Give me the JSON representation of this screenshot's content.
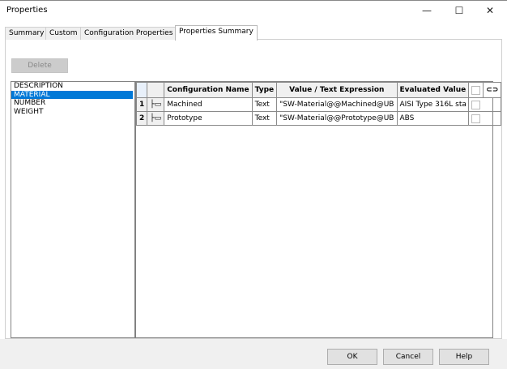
{
  "window": {
    "title": "Properties",
    "minimize": "—",
    "maximize": "☐",
    "close": "✕"
  },
  "tabs": [
    {
      "label": "Summary"
    },
    {
      "label": "Custom"
    },
    {
      "label": "Configuration Properties"
    },
    {
      "label": "Properties Summary",
      "active": true
    }
  ],
  "toolbar": {
    "delete_label": "Delete"
  },
  "properties_list": {
    "items": [
      "DESCRIPTION",
      "MATERIAL",
      "NUMBER",
      "WEIGHT"
    ],
    "selected": "MATERIAL"
  },
  "grid": {
    "headers": [
      "",
      "",
      "Configuration Name",
      "Type",
      "Value / Text Expression",
      "Evaluated Value",
      "",
      ""
    ],
    "link_icon": "link-icon",
    "rows": [
      {
        "num": "1",
        "config": "Machined",
        "type": "Text",
        "value": "\"SW-Material@@Machined@UB",
        "evaluated": "AISI Type 316L sta",
        "checked": false
      },
      {
        "num": "2",
        "config": "Prototype",
        "type": "Text",
        "value": "\"SW-Material@@Prototype@UB",
        "evaluated": "ABS",
        "checked": false
      }
    ]
  },
  "footer": {
    "ok": "OK",
    "cancel": "Cancel",
    "help": "Help"
  },
  "colors": {
    "selection": "#0078d7"
  }
}
